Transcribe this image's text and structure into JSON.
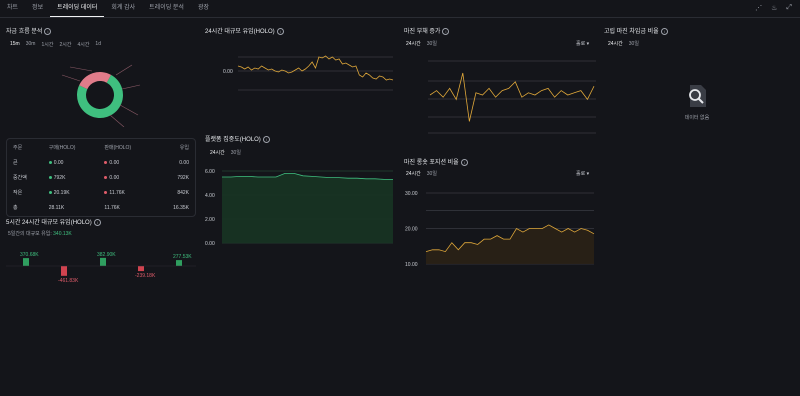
{
  "tabs": [
    "차트",
    "정보",
    "트레이딩 데이터",
    "회계 감사",
    "트레이딩 분석",
    "광장"
  ],
  "active_tab": 2,
  "capital_flow": {
    "title": "자금 흐름 분석",
    "timeframes": [
      "15m",
      "30m",
      "1시간",
      "2시간",
      "4시간",
      "1d"
    ],
    "selected": "15m",
    "table": {
      "headers": [
        "주문",
        "구매(HOLO)",
        "판매(HOLO)",
        "유입"
      ],
      "rows": [
        {
          "label": "큰",
          "buy": "0.00",
          "sell": "0.00",
          "inflow": "0.00"
        },
        {
          "label": "중간액",
          "buy": "792K",
          "sell": "0.00",
          "inflow": "792K"
        },
        {
          "label": "작은",
          "buy": "20.19K",
          "sell": "11.76K",
          "inflow": "842K"
        },
        {
          "label": "총",
          "buy": "28.11K",
          "sell": "11.76K",
          "inflow": "16.35K"
        }
      ]
    }
  },
  "inflow_5h": {
    "title": "5시간 24시간 대규모 유입(HOLO)",
    "summary_label": "5일간의 대규모 유입:",
    "summary_value": "340.13K"
  },
  "inflow_24h": {
    "title": "24시간 대규모 유입(HOLO)"
  },
  "concentration": {
    "title": "플랫폼 집중도(HOLO)",
    "tabs": [
      "24시간",
      "30일"
    ]
  },
  "margin_debt": {
    "title": "마진 부채 증가",
    "tabs": [
      "24시간",
      "30일"
    ],
    "dropdown": "홀로"
  },
  "margin_ls": {
    "title": "마진 롱숏 포지션 비율",
    "tabs": [
      "24시간",
      "30일"
    ],
    "dropdown": "홀로"
  },
  "isolated_margin": {
    "title": "고립 마진 차입금 비율",
    "tabs": [
      "24시간",
      "30일"
    ],
    "empty_text": "데이터 없음"
  },
  "colors": {
    "accent_green": "#3fbf7f",
    "accent_red": "#e05c6a",
    "line_gold": "#e0a83a",
    "bg": "#14151a"
  },
  "chart_data": [
    {
      "type": "pie",
      "title": "",
      "labels": [],
      "values": [
        74,
        26
      ],
      "colors": [
        "#3fbf7f",
        "#e07c8a"
      ]
    },
    {
      "type": "bar",
      "title": "5시간 24시간 대규모 유입(HOLO)",
      "values": [
        370680,
        -461830,
        382900,
        -239180,
        277530
      ],
      "value_labels": [
        "370.68K",
        "-461.83K",
        "382.90K",
        "-239.18K",
        "277.53K"
      ]
    },
    {
      "type": "line",
      "title": "24시간 대규모 유입(HOLO)",
      "y_ticks": [
        "0.00"
      ],
      "values": [
        0.5,
        0.4,
        0.2,
        0.4,
        0.1,
        0.3,
        0.2,
        0.5,
        0.3,
        0.1,
        0.2,
        0.0,
        -0.1,
        0.1,
        0.0,
        -0.2,
        -0.1,
        0.1,
        0.3,
        0.0,
        0.2,
        0.5,
        0.9,
        0.3,
        1.4,
        1.3,
        1.5,
        1.2,
        1.4,
        1.1,
        1.2,
        0.7,
        0.8,
        0.6,
        0.4,
        0.5,
        -0.4,
        -0.6,
        -0.2,
        -0.4,
        -0.7,
        -0.8,
        -0.5,
        -0.6,
        -0.9,
        -0.8,
        -0.9
      ]
    },
    {
      "type": "area",
      "title": "플랫폼 집중도(HOLO)",
      "y_ticks": [
        "0.00",
        "2.00",
        "4.00",
        "6.00"
      ],
      "ylim": [
        0,
        6
      ],
      "values": [
        5.5,
        5.5,
        5.55,
        5.55,
        5.5,
        5.5,
        5.5,
        5.8,
        5.8,
        5.6,
        5.55,
        5.5,
        5.45,
        5.45,
        5.4,
        5.4,
        5.35,
        5.35,
        5.3,
        5.3
      ]
    },
    {
      "type": "line",
      "title": "마진 부채 증가",
      "values": [
        0.0,
        0.2,
        -0.1,
        0.3,
        -0.2,
        1.0,
        -1.2,
        0.1,
        0.0,
        0.3,
        -0.1,
        0.2,
        0.3,
        0.6,
        -0.1,
        0.1,
        0.0,
        0.2,
        0.3,
        -0.1,
        0.2,
        0.0,
        0.1,
        0.2,
        -0.2,
        0.4
      ]
    },
    {
      "type": "area",
      "title": "마진 롱숏 포지션 비율",
      "y_ticks": [
        "10.00",
        "20.00",
        "30.00"
      ],
      "ylim": [
        10,
        30
      ],
      "values": [
        13.5,
        14,
        14,
        13.5,
        16,
        14,
        16,
        16,
        15.5,
        17,
        17,
        18,
        17,
        17,
        20,
        19,
        20,
        20,
        20,
        21,
        20,
        19,
        20,
        19,
        20,
        19.5,
        18.5
      ]
    }
  ]
}
